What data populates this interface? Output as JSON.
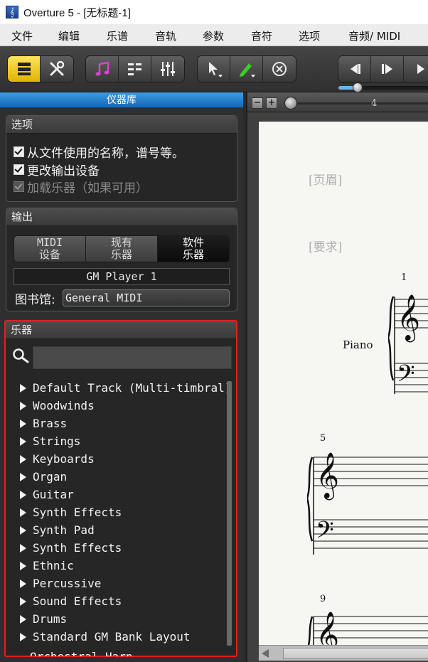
{
  "window": {
    "title": "Overture 5 - [无标题-1]",
    "app_icon": "treble-clef-app-icon"
  },
  "menu": [
    "文件",
    "编辑",
    "乐谱",
    "音轨",
    "参数",
    "音符",
    "选项",
    "音频/ MIDI"
  ],
  "toolbar": {
    "groups": [
      [
        "instrument-library-icon",
        "tools-icon"
      ],
      [
        "music-note-icon",
        "list-icon",
        "mixer-icon"
      ],
      [
        "pointer-tool-icon",
        "pencil-tool-icon",
        "cancel-icon"
      ],
      [
        "rewind-icon",
        "play-icon",
        "fast-forward-icon"
      ]
    ],
    "accent_yellow": "#f2c800",
    "accent_pink": "#e040d0",
    "accent_green": "#3ecb2a"
  },
  "left_panel": {
    "header": "仪器库",
    "options": {
      "title": "选项",
      "checkboxes": [
        {
          "label": "从文件使用的名称，谱号等。",
          "checked": true,
          "enabled": true
        },
        {
          "label": "更改输出设备",
          "checked": true,
          "enabled": true
        },
        {
          "label": "加载乐器（如果可用）",
          "checked": true,
          "enabled": false
        }
      ]
    },
    "output": {
      "title": "输出",
      "segments": [
        {
          "line1": "MIDI",
          "line2": "设备",
          "active": false
        },
        {
          "line1": "现有",
          "line2": "乐器",
          "active": false
        },
        {
          "line1": "软件",
          "line2": "乐器",
          "active": true
        }
      ],
      "player": "GM Player 1",
      "library_label": "图书馆:",
      "library_value": "General MIDI"
    },
    "instruments": {
      "title": "乐器",
      "search_placeholder": "",
      "items": [
        "Default Track (Multi-timbral)",
        "Woodwinds",
        "Brass",
        "Strings",
        "Keyboards",
        "Organ",
        "Guitar",
        "Synth Effects",
        "Synth Pad",
        "Synth Effects",
        "Ethnic",
        "Percussive",
        "Sound Effects",
        "Drums",
        "Standard GM Bank Layout"
      ],
      "partial_item": "Orchestral Harp",
      "highlight_color": "#e02020"
    }
  },
  "score": {
    "page_number": "4",
    "header_placeholder": "[页眉]",
    "request_placeholder": "[要求]",
    "instrument_label": "Piano",
    "measure_numbers": [
      "1",
      "5",
      "9"
    ]
  }
}
